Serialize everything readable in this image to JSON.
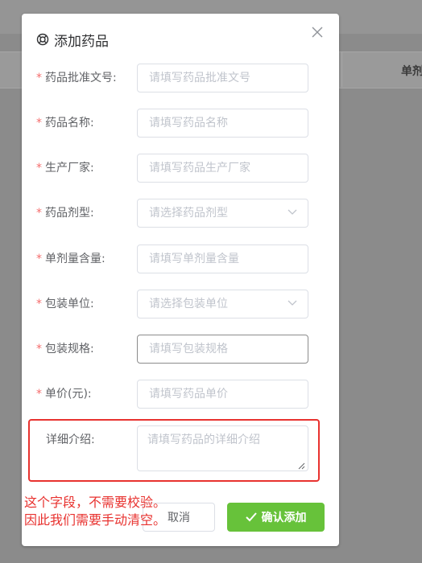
{
  "background": {
    "table_header": "单剂"
  },
  "dialog": {
    "title": "添加药品",
    "title_icon": "lifebuoy-icon",
    "close_icon": "close-icon",
    "fields": [
      {
        "label": "药品批准文号:",
        "required": true,
        "type": "input",
        "placeholder": "请填写药品批准文号"
      },
      {
        "label": "药品名称:",
        "required": true,
        "type": "input",
        "placeholder": "请填写药品名称"
      },
      {
        "label": "生产厂家:",
        "required": true,
        "type": "input",
        "placeholder": "请填写药品生产厂家"
      },
      {
        "label": "药品剂型:",
        "required": true,
        "type": "select",
        "placeholder": "请选择药品剂型"
      },
      {
        "label": "单剂量含量:",
        "required": true,
        "type": "input",
        "placeholder": "请填写单剂量含量"
      },
      {
        "label": "包装单位:",
        "required": true,
        "type": "select",
        "placeholder": "请选择包装单位"
      },
      {
        "label": "包装规格:",
        "required": true,
        "type": "input",
        "placeholder": "请填写包装规格"
      },
      {
        "label": "单价(元):",
        "required": true,
        "type": "input",
        "placeholder": "请填写药品单价"
      },
      {
        "label": "详细介绍:",
        "required": false,
        "type": "textarea",
        "placeholder": "请填写药品的详细介绍"
      }
    ],
    "required_mark": "*",
    "buttons": {
      "cancel": "取消",
      "confirm": "确认添加"
    }
  },
  "annotation": {
    "line1": "这个字段，不需要校验。",
    "line2": "因此我们需要手动清空。",
    "color": "#e8322f"
  },
  "colors": {
    "confirm": "#67c23a",
    "required": "#f56c6c"
  }
}
